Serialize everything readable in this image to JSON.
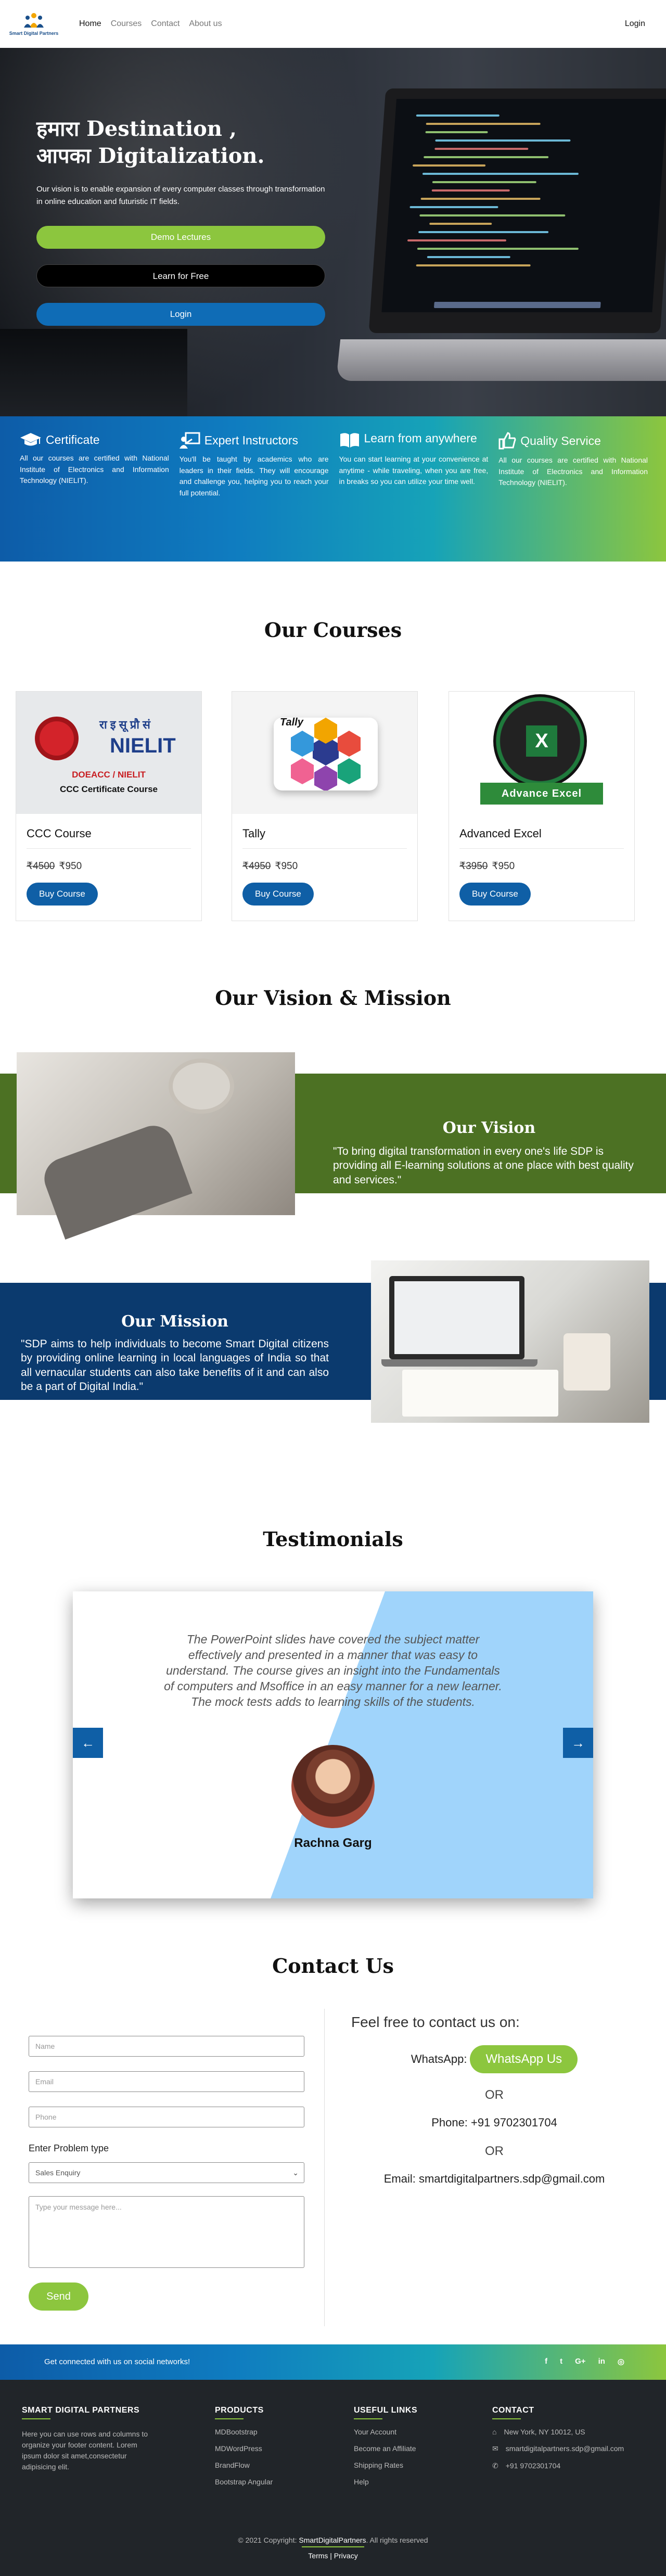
{
  "nav": {
    "brand": "Smart Digital Partners",
    "links": [
      "Home",
      "Courses",
      "Contact",
      "About us"
    ],
    "login": "Login"
  },
  "hero": {
    "title_line1": "हमारा Destination ,",
    "title_line2": "आपका Digitalization.",
    "subtitle": "Our vision is to enable expansion of every computer classes through transformation in online education and futuristic IT fields.",
    "btn_demo": "Demo Lectures",
    "btn_free": "Learn for Free",
    "btn_login": "Login"
  },
  "features": [
    {
      "icon": "graduation-cap-icon",
      "title": "Certificate",
      "text": "All our courses are certified with National Institute of Electronics and Information Technology (NIELIT)."
    },
    {
      "icon": "teacher-board-icon",
      "title": "Expert Instructors",
      "text": "You'll be taught by academics who are leaders in their fields. They will encourage and challenge you, helping you to reach your full potential."
    },
    {
      "icon": "open-book-icon",
      "title": "Learn from anywhere",
      "text": "You can start learning at your convenience at anytime - while traveling, when you are free, in breaks so you can utilize your time well."
    },
    {
      "icon": "thumbs-up-icon",
      "title": "Quality Service",
      "text": "All our courses are certified with National Institute of Electronics and Information Technology (NIELIT)."
    }
  ],
  "courses_title": "Our Courses",
  "courses": [
    {
      "name": "CCC Course",
      "old_price": "₹4500",
      "price": "₹950",
      "button": "Buy Course",
      "img_line1": "DOEACC / NIELIT",
      "img_line2": "CCC Certificate Course",
      "img_logo": "NIELIT",
      "img_hindi": "रा इ सू प्रौ सं"
    },
    {
      "name": "Tally",
      "old_price": "₹4950",
      "price": "₹950",
      "button": "Buy Course",
      "img_logo": "Tally"
    },
    {
      "name": "Advanced Excel",
      "old_price": "₹3950",
      "price": "₹950",
      "button": "Buy Course",
      "img_logo": "Advance Excel"
    }
  ],
  "vm_title": "Our Vision & Mission",
  "vision": {
    "title": "Our Vision",
    "text": "\"To bring digital transformation in every one's life SDP is providing all E-learning solutions at one place with best quality and services.\""
  },
  "mission": {
    "title": "Our Mission",
    "text": "\"SDP aims to help individuals to become Smart Digital citizens by providing online learning in local languages of India so that all vernacular students can also take benefits of it and can also be a part of Digital India.\""
  },
  "testimonials": {
    "title": "Testimonials",
    "quote": "The PowerPoint slides have covered the subject matter effectively and presented in a manner that was easy to understand. The course gives an insight into the Fundamentals of computers and Msoffice in an easy manner for a new learner. The mock tests adds to learning skills of the students.",
    "name": "Rachna Garg",
    "prev": "←",
    "next": "→"
  },
  "contact": {
    "title": "Contact Us",
    "name_ph": "Name",
    "email_ph": "Email",
    "phone_ph": "Phone",
    "problem_label": "Enter Problem type",
    "problem_value": "Sales Enquiry",
    "message_ph": "Type your message here...",
    "send": "Send",
    "right_title": "Feel free to contact us on:",
    "whatsapp_label": "WhatsApp:",
    "whatsapp_btn": "WhatsApp Us",
    "or": "OR",
    "phone": "Phone: +91 9702301704",
    "email": "Email: smartdigitalpartners.sdp@gmail.com"
  },
  "social": {
    "text": "Get connected with us on social networks!",
    "icons": [
      "f",
      "t",
      "G+",
      "in",
      "◎"
    ]
  },
  "footer": {
    "col1_title": "SMART DIGITAL PARTNERS",
    "col1_text": "Here you can use rows and columns to organize your footer content. Lorem ipsum dolor sit amet,consectetur adipisicing elit.",
    "col2_title": "PRODUCTS",
    "col2_items": [
      "MDBootstrap",
      "MDWordPress",
      "BrandFlow",
      "Bootstrap Angular"
    ],
    "col3_title": "USEFUL LINKS",
    "col3_items": [
      "Your Account",
      "Become an Affiliate",
      "Shipping Rates",
      "Help"
    ],
    "col4_title": "CONTACT",
    "col4_items": [
      "New York, NY 10012, US",
      "smartdigitalpartners.sdp@gmail.com",
      "+91 9702301704"
    ],
    "copyright_pre": "© 2021 Copyright: ",
    "copyright_brand": "SmartDigitalPartners",
    "copyright_post": ". All rights reserved",
    "terms": "Terms | Privacy"
  },
  "colors": {
    "primary_blue": "#0f5fa6",
    "green": "#8cc63e",
    "vision_green": "#4c7123",
    "mission_navy": "#0b3a6e",
    "footer_dark": "#212529"
  }
}
